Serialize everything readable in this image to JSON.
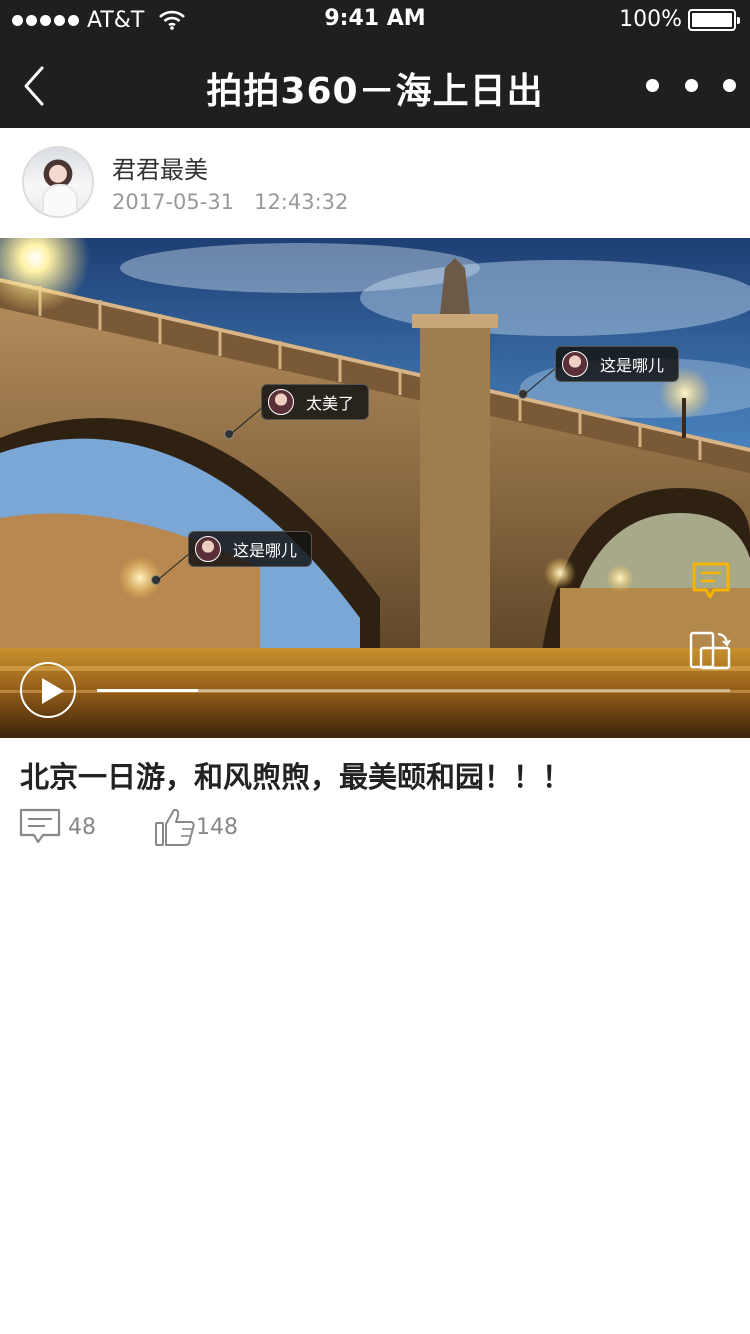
{
  "status_bar": {
    "carrier": "AT&T",
    "time": "9:41 AM",
    "battery": "100%"
  },
  "nav": {
    "title": "拍拍360－海上日出"
  },
  "post": {
    "author_name": "君君最美",
    "date": "2017-05-31",
    "time": "12:43:32",
    "caption": "北京一日游，和风煦煦，最美颐和园！！！",
    "comment_count": "48",
    "like_count": "148"
  },
  "photo": {
    "tags": [
      {
        "text": "太美了"
      },
      {
        "text": "这是哪儿"
      },
      {
        "text": "这是哪儿"
      }
    ],
    "video_progress": 0.16
  },
  "colors": {
    "bar_background": "#1f1f1f",
    "accent_yellow": "#f5b400",
    "muted_text": "#999999"
  }
}
